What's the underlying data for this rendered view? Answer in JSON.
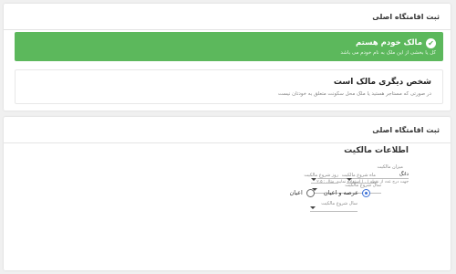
{
  "card1": {
    "title": "ثبت اقامتگاه اصلی",
    "owner_option": {
      "check_icon": "✔",
      "title": "مالک خودم هستم",
      "subtitle": "کل یا بخشی از این ملک به نام خودم می باشد"
    },
    "other_option": {
      "title": "شخص دیگری مالک است",
      "subtitle": "در صورتی که مستاجر هستید یا ملک محل سکونت متعلق به خودتان نیست"
    }
  },
  "card2": {
    "title": "ثبت اقامتگاه اصلی",
    "section_title": "اطلاعات مالکیت",
    "ownership_amount": {
      "label": "میزان مالکیت",
      "unit": "دانگ",
      "hint": "جهت درج عدد از نقطه ( . ) استفاده نمایید. مثال : ۲.۵"
    },
    "start_day": "روز شروع مالکیت",
    "start_month": "ماه شروع مالکیت",
    "start_year_1": "سال شروع مالکیت",
    "radio": {
      "option_1": "عرصه و اعیان",
      "option_2": "اعیان",
      "selected": "عرصه و اعیان"
    },
    "start_year_2": "سال شروع مالکیت"
  },
  "colors": {
    "selected_green": "#5cb85c",
    "radio_blue": "#3a6fd8"
  }
}
